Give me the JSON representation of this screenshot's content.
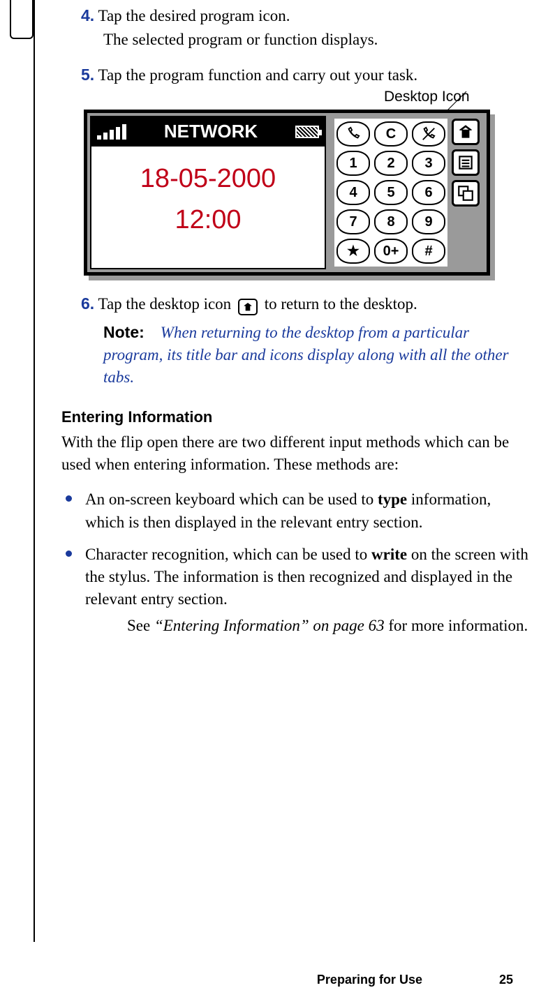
{
  "steps": {
    "s4": {
      "num": "4.",
      "text": "Tap the desired program icon.",
      "follow": "The selected program or function displays."
    },
    "s5": {
      "num": "5.",
      "text": "Tap the program function and carry out your task."
    },
    "s6": {
      "num": "6.",
      "before": "Tap the desktop icon ",
      "after": " to return to the desktop."
    }
  },
  "callout": "Desktop Icon",
  "device": {
    "title": "NETWORK",
    "date": "18-05-2000",
    "time": "12:00",
    "keys": {
      "c": "C",
      "k1": "1",
      "k2": "2",
      "k3": "3",
      "k4": "4",
      "k5": "5",
      "k6": "6",
      "k7": "7",
      "k8": "8",
      "k9": "9",
      "star": "★",
      "k0": "0+",
      "hash": "#"
    }
  },
  "note": {
    "label": "Note:",
    "text": "When returning to the desktop from a particular program, its title bar and icons display along with all the other tabs."
  },
  "section": {
    "heading": "Entering Information",
    "intro": "With the flip open there are two different input methods which can be used when entering information. These methods are:",
    "b1_a": "An on-screen keyboard which can be used to ",
    "b1_bold": "type",
    "b1_b": " information, which is then displayed in the relevant entry section.",
    "b2_a": "Character recognition, which can be used to ",
    "b2_bold": "write",
    "b2_b": " on the screen with the stylus. The information is then recognized and displayed in the relevant entry section.",
    "see_a": "See ",
    "see_ref": "“Entering Information” on page 63",
    "see_b": " for more information."
  },
  "footer": {
    "section": "Preparing for Use",
    "page": "25"
  }
}
